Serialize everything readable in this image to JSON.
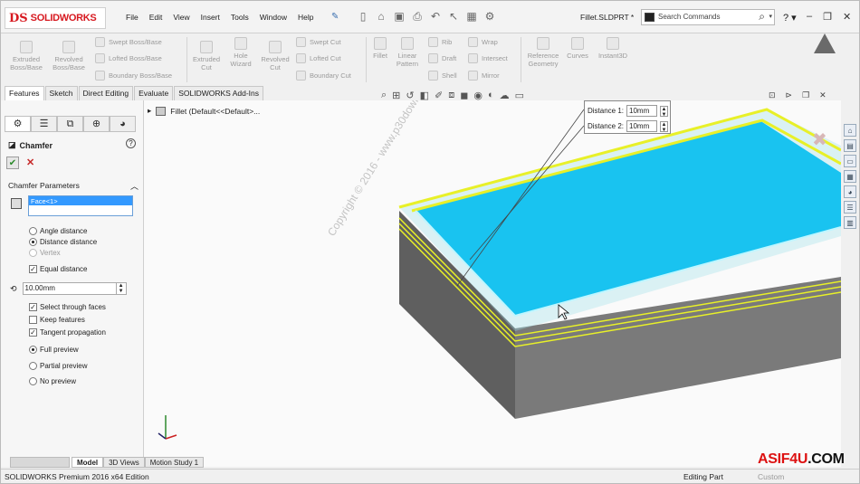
{
  "app": {
    "brand_ds": "DS",
    "brand_name": "SOLIDWORKS"
  },
  "menu": [
    "File",
    "Edit",
    "View",
    "Insert",
    "Tools",
    "Window",
    "Help"
  ],
  "file_name": "Fillet.SLDPRT *",
  "search": {
    "placeholder": "Search Commands"
  },
  "toolbar": {
    "extruded_boss": "Extruded Boss/Base",
    "revolved_boss": "Revolved Boss/Base",
    "swept_boss": "Swept Boss/Base",
    "lofted_boss": "Lofted Boss/Base",
    "boundary_boss": "Boundary Boss/Base",
    "extruded_cut": "Extruded Cut",
    "hole_wizard": "Hole Wizard",
    "revolved_cut": "Revolved Cut",
    "swept_cut": "Swept Cut",
    "lofted_cut": "Lofted Cut",
    "boundary_cut": "Boundary Cut",
    "fillet": "Fillet",
    "linear_pattern": "Linear Pattern",
    "rib": "Rib",
    "draft": "Draft",
    "shell": "Shell",
    "wrap": "Wrap",
    "intersect": "Intersect",
    "mirror": "Mirror",
    "reference_geometry": "Reference Geometry",
    "curves": "Curves",
    "instant3d": "Instant3D"
  },
  "tabs": [
    "Features",
    "Sketch",
    "Direct Editing",
    "Evaluate",
    "SOLIDWORKS Add-Ins"
  ],
  "property_manager": {
    "title": "Chamfer",
    "group_title": "Chamfer Parameters",
    "selection": "Face<1>",
    "options": {
      "angle_distance": "Angle distance",
      "distance_distance": "Distance distance",
      "vertex": "Vertex",
      "equal_distance": "Equal distance",
      "distance_value": "10.00mm",
      "select_through_faces": "Select through faces",
      "keep_features": "Keep features",
      "tangent_propagation": "Tangent propagation",
      "full_preview": "Full preview",
      "partial_preview": "Partial preview",
      "no_preview": "No preview"
    }
  },
  "feature_tree": {
    "item": "Fillet (Default<<Default>..."
  },
  "callout": {
    "d1_label": "Distance 1:",
    "d1_value": "10mm",
    "d2_label": "Distance 2:",
    "d2_value": "10mm"
  },
  "watermark": {
    "line1": "Copyright © 2016 - www.p30download.com"
  },
  "bottom_tabs": [
    "Model",
    "3D Views",
    "Motion Study 1"
  ],
  "status": {
    "edition": "SOLIDWORKS Premium 2016 x64 Edition",
    "mode": "Editing Part",
    "units": "Custom"
  },
  "brand_overlay": {
    "name": "ASIF4U",
    "suffix": ".COM"
  },
  "colors": {
    "face_fill": "#19c3f0",
    "chamfer_edge": "#e8f028",
    "body_side": "#6e6e6e",
    "accent_red": "#d71920"
  }
}
